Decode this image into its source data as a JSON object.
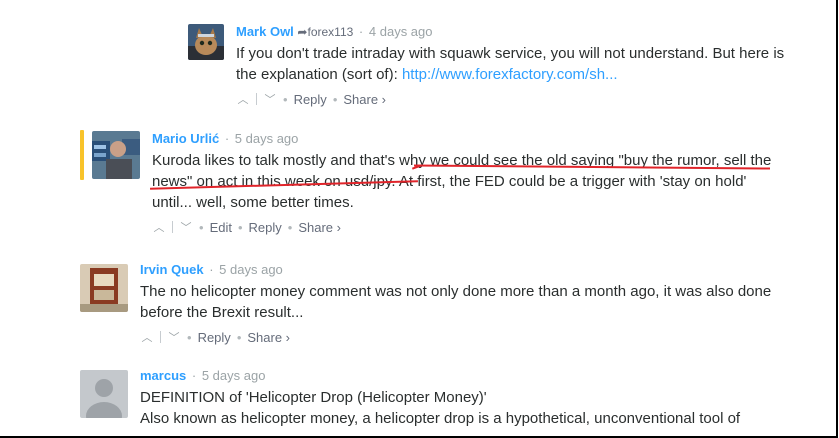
{
  "comments": [
    {
      "author": "Mark Owl",
      "reply_to": "forex113",
      "time": "4 days ago",
      "text_before_link": "If you don't trade intraday with squawk service, you will not understand. But here is the explanation (sort of): ",
      "link": "http://www.forexfactory.com/sh...",
      "actions": {
        "reply": "Reply",
        "share": "Share ›"
      }
    },
    {
      "author": "Mario Urlić",
      "time": "5 days ago",
      "text": "Kuroda likes to talk mostly and that's why we could see the old saying \"buy the rumor, sell the news\" on act in this week on usd/jpy. At first, the FED could be a trigger with 'stay on hold' until... well, some better times.",
      "actions": {
        "edit": "Edit",
        "reply": "Reply",
        "share": "Share ›"
      }
    },
    {
      "author": "Irvin Quek",
      "time": "5 days ago",
      "text": "The no helicopter money comment was not only done more than a month ago, it was also done before the Brexit result...",
      "actions": {
        "reply": "Reply",
        "share": "Share ›"
      }
    },
    {
      "author": "marcus",
      "time": "5 days ago",
      "line1": "DEFINITION of 'Helicopter Drop (Helicopter Money)'",
      "line2": "Also known as helicopter money, a helicopter drop is a hypothetical, unconventional tool of"
    }
  ],
  "colors": {
    "author": "#2e9fff",
    "highlight_bar": "#f8c32a",
    "annotation_underline": "#e0242a"
  }
}
